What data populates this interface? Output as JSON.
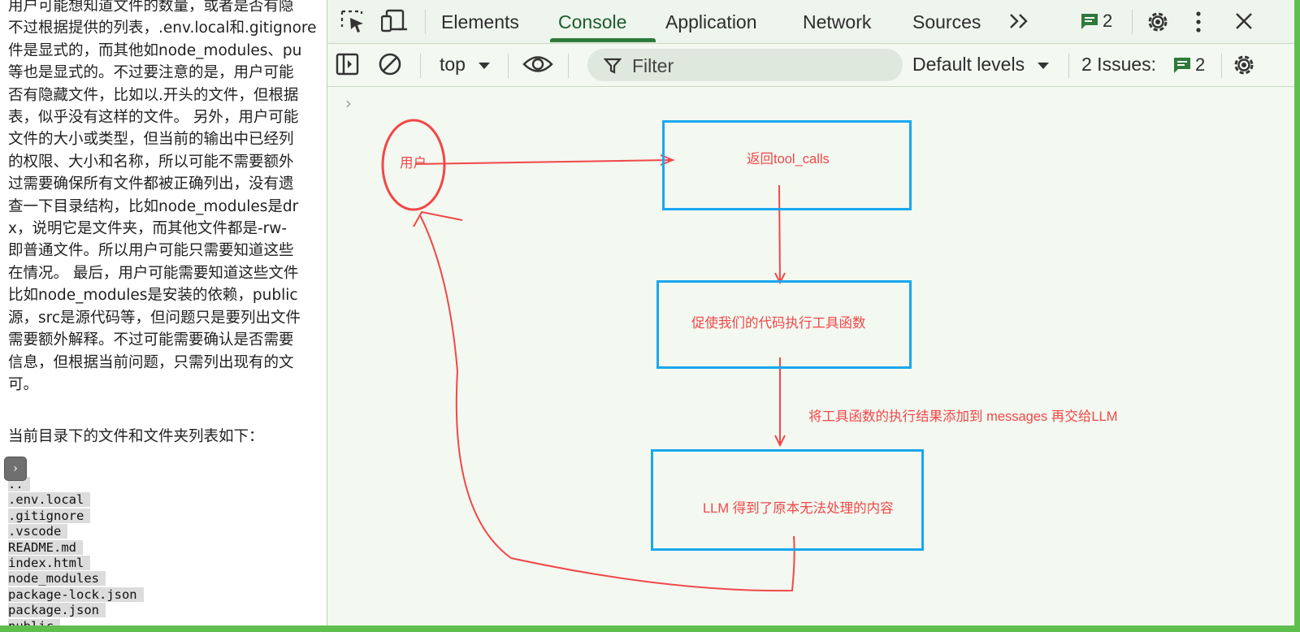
{
  "page_text": {
    "lines": [
      "用户可能想知道文件的数量，或者是否有隐",
      "不过根据提供的列表，.env.local和.gitignore",
      "件是显式的，而其他如node_modules、pu",
      "等也是显式的。不过要注意的是，用户可能",
      "否有隐藏文件，比如以.开头的文件，但根据",
      "表，似乎没有这样的文件。 另外，用户可能",
      "文件的大小或类型，但当前的输出中已经列",
      "的权限、大小和名称，所以可能不需要额外",
      "过需要确保所有文件都被正确列出，没有遗",
      "查一下目录结构，比如node_modules是dr",
      "x，说明它是文件夹，而其他文件都是-rw-",
      "即普通文件。所以用户可能只需要知道这些",
      "在情况。 最后，用户可能需要知道这些文件",
      "比如node_modules是安装的依赖，public",
      "源，src是源代码等，但问题只是要列出文件",
      "需要额外解释。不过可能需要确认是否需要",
      "信息，但根据当前问题，只需列出现有的文",
      "可。"
    ],
    "subheading": "当前目录下的文件和文件夹列表如下：",
    "file_list": [
      "..",
      ".env.local",
      ".gitignore",
      ".vscode",
      "README.md",
      "index.html",
      "node_modules",
      "package-lock.json",
      "package.json",
      "public"
    ]
  },
  "devtools": {
    "tabs": [
      "Elements",
      "Console",
      "Application",
      "Network",
      "Sources"
    ],
    "active_tab": "Console",
    "message_count": "2",
    "context_select": "top",
    "filter_placeholder": "Filter",
    "levels_select": "Default levels",
    "issues_label": "2 Issues:",
    "issues_count": "2",
    "console_prompt": "›"
  },
  "diagram": {
    "user_label": "用户",
    "box1_label": "返回tool_calls",
    "box2_label": "促使我们的代码执行工具函数",
    "arrow_label": "将工具函数的执行结果添加到 messages 再交给LLM",
    "box3_label": "LLM 得到了原本无法处理的内容"
  },
  "colors": {
    "accent": "#2f7a3b",
    "annotation_red": "#f04848",
    "box_blue": "#1aa7ee",
    "window_border_green": "#5fbf4e"
  }
}
